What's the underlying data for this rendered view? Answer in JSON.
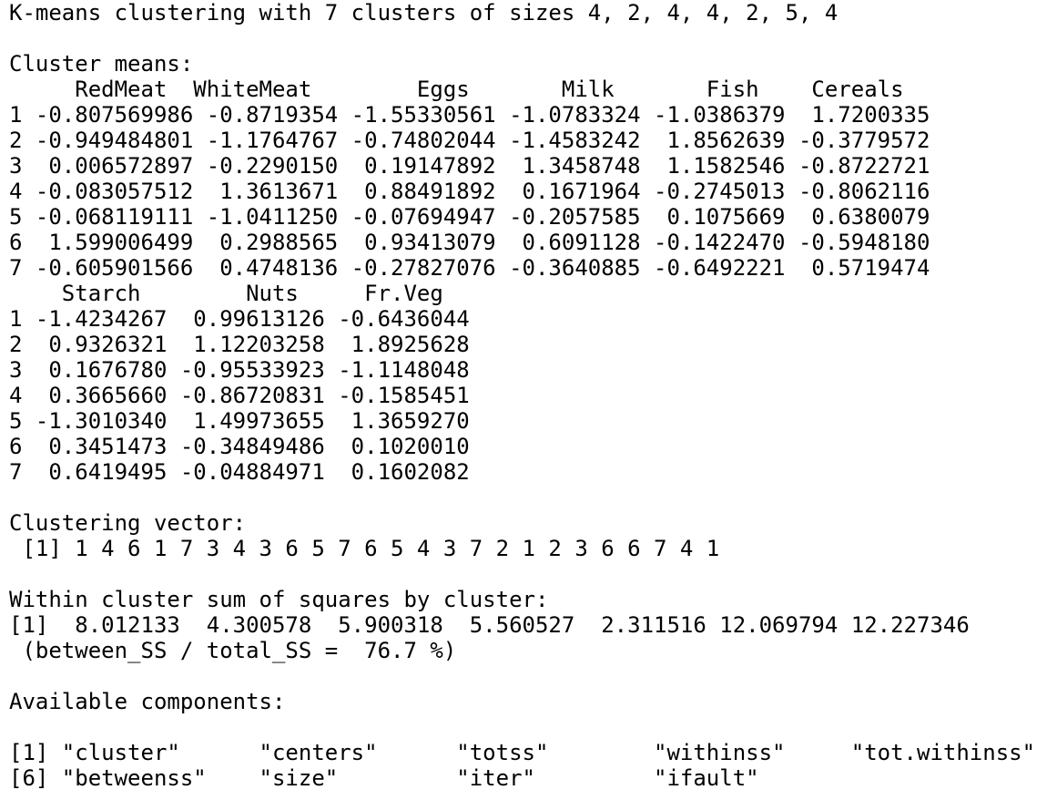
{
  "console": {
    "lines": [
      "K-means clustering with 7 clusters of sizes 4, 2, 4, 4, 2, 5, 4",
      "",
      "Cluster means:",
      "     RedMeat  WhiteMeat        Eggs       Milk       Fish    Cereals",
      "1 -0.807569986 -0.8719354 -1.55330561 -1.0783324 -1.0386379  1.7200335",
      "2 -0.949484801 -1.1764767 -0.74802044 -1.4583242  1.8562639 -0.3779572",
      "3  0.006572897 -0.2290150  0.19147892  1.3458748  1.1582546 -0.8722721",
      "4 -0.083057512  1.3613671  0.88491892  0.1671964 -0.2745013 -0.8062116",
      "5 -0.068119111 -1.0411250 -0.07694947 -0.2057585  0.1075669  0.6380079",
      "6  1.599006499  0.2988565  0.93413079  0.6091128 -0.1422470 -0.5948180",
      "7 -0.605901566  0.4748136 -0.27827076 -0.3640885 -0.6492221  0.5719474",
      "    Starch        Nuts     Fr.Veg",
      "1 -1.4234267  0.99613126 -0.6436044",
      "2  0.9326321  1.12203258  1.8925628",
      "3  0.1676780 -0.95533923 -1.1148048",
      "4  0.3665660 -0.86720831 -0.1585451",
      "5 -1.3010340  1.49973655  1.3659270",
      "6  0.3451473 -0.34849486  0.1020010",
      "7  0.6419495 -0.04884971  0.1602082",
      "",
      "Clustering vector:",
      " [1] 1 4 6 1 7 3 4 3 6 5 7 6 5 4 3 7 2 1 2 3 6 6 7 4 1",
      "",
      "Within cluster sum of squares by cluster:",
      "[1]  8.012133  4.300578  5.900318  5.560527  2.311516 12.069794 12.227346",
      " (between_SS / total_SS =  76.7 %)",
      "",
      "Available components:",
      "",
      "[1] \"cluster\"      \"centers\"      \"totss\"        \"withinss\"     \"tot.withinss\"",
      "[6] \"betweenss\"    \"size\"         \"iter\"         \"ifault\""
    ]
  }
}
